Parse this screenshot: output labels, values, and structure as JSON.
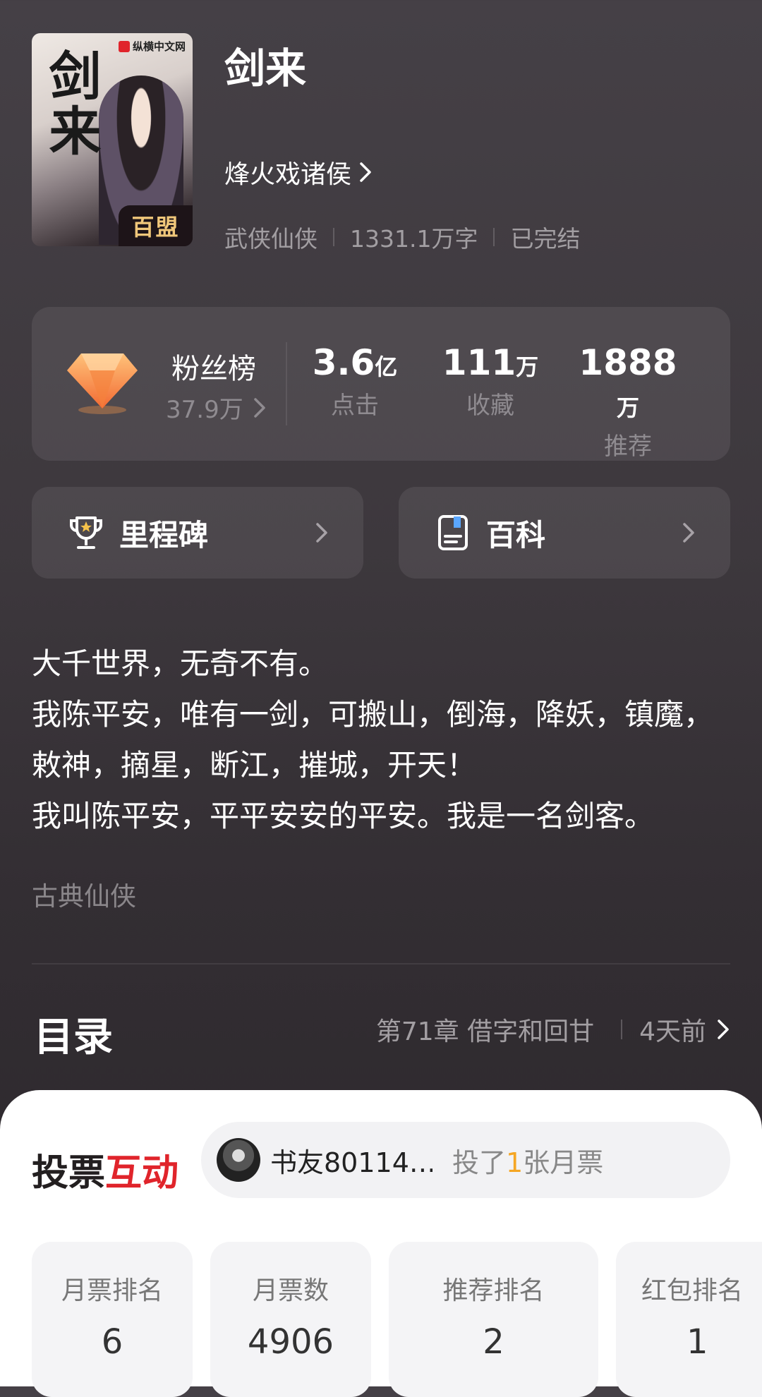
{
  "book": {
    "title": "剑来",
    "author": "烽火戏诸侯",
    "category": "武侠仙侠",
    "word_count": "1331.1万字",
    "status": "已完结",
    "cover": {
      "brand": "纵横中文网",
      "calligraphy": "剑来",
      "tag": "百盟"
    }
  },
  "stats": {
    "fans_label": "粉丝榜",
    "fans_count": "37.9万",
    "items": [
      {
        "value": "3.6",
        "unit": "亿",
        "label": "点击"
      },
      {
        "value": "111",
        "unit": "万",
        "label": "收藏"
      },
      {
        "value": "1888",
        "unit": "万",
        "label": "推荐"
      }
    ]
  },
  "links": {
    "milestone": "里程碑",
    "wiki": "百科"
  },
  "intro": [
    "大千世界，无奇不有。",
    "我陈平安，唯有一剑，可搬山，倒海，降妖，镇魔，敕神，摘星，断江，摧城，开天！",
    "我叫陈平安，平平安安的平安。我是一名剑客。"
  ],
  "genre_tag": "古典仙侠",
  "catalog": {
    "title": "目录",
    "latest_chapter": "第71章 借字和回甘",
    "updated": "4天前"
  },
  "vote": {
    "title_a": "投票",
    "title_b": "互动",
    "ticker_user": "书友80114…",
    "ticker_prefix": "投了",
    "ticker_count": "1",
    "ticker_suffix": "张月票",
    "cards": [
      {
        "label": "月票排名",
        "value": "6"
      },
      {
        "label": "月票数",
        "value": "4906"
      },
      {
        "label": "推荐排名",
        "value": "2"
      },
      {
        "label": "红包排名",
        "value": "1"
      }
    ]
  }
}
